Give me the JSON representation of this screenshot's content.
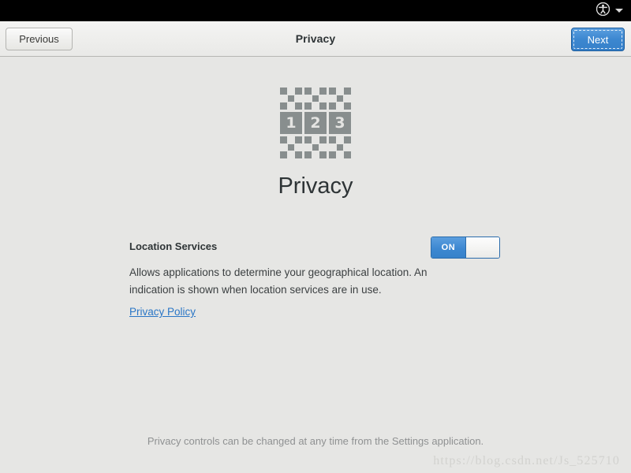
{
  "topbar": {
    "accessibility_icon": "accessibility-person-icon",
    "dropdown_icon": "chevron-down-icon"
  },
  "header": {
    "title": "Privacy",
    "previous_label": "Previous",
    "next_label": "Next",
    "next_accent_color": "#3c87d0"
  },
  "logo": {
    "name": "initial-setup-123-icon",
    "numbers": [
      "1",
      "2",
      "3"
    ],
    "tile_color": "#888e8e"
  },
  "main": {
    "page_title": "Privacy",
    "setting": {
      "label": "Location Services",
      "toggle_state": "ON",
      "toggle_on_color": "#3d88d1"
    },
    "description": "Allows applications to determine your geographical location. An indication is shown when location services are in use.",
    "link_label": "Privacy Policy",
    "link_color": "#2a76c6",
    "footer_note": "Privacy controls can be changed at any time from the Settings application."
  },
  "watermark": {
    "text": "https://blog.csdn.net/Js_525710"
  }
}
